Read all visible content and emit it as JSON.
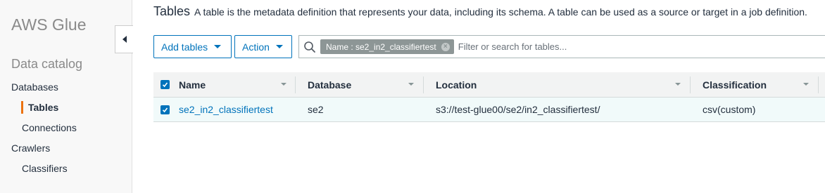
{
  "sidebar": {
    "app_title": "AWS Glue",
    "section_title": "Data catalog",
    "items": [
      {
        "label": "Databases"
      },
      {
        "label": "Tables"
      },
      {
        "label": "Connections"
      },
      {
        "label": "Crawlers"
      },
      {
        "label": "Classifiers"
      }
    ],
    "active_item": "Tables"
  },
  "header": {
    "title": "Tables",
    "description": "A table is the metadata definition that represents your data, including its schema. A table can be used as a source or target in a job definition."
  },
  "toolbar": {
    "add_tables_label": "Add tables",
    "action_label": "Action"
  },
  "search": {
    "filter_token": "Name : se2_in2_classifiertest",
    "placeholder": "Filter or search for tables..."
  },
  "table": {
    "columns": [
      "Name",
      "Database",
      "Location",
      "Classification"
    ],
    "rows": [
      {
        "selected": true,
        "name": "se2_in2_classifiertest",
        "database": "se2",
        "location": "s3://test-glue00/se2/in2_classifiertest/",
        "classification": "csv(custom)"
      }
    ]
  },
  "colors": {
    "accent": "#0073bb",
    "active_marker": "#ec7211",
    "selected_row": "#f1fafa"
  }
}
